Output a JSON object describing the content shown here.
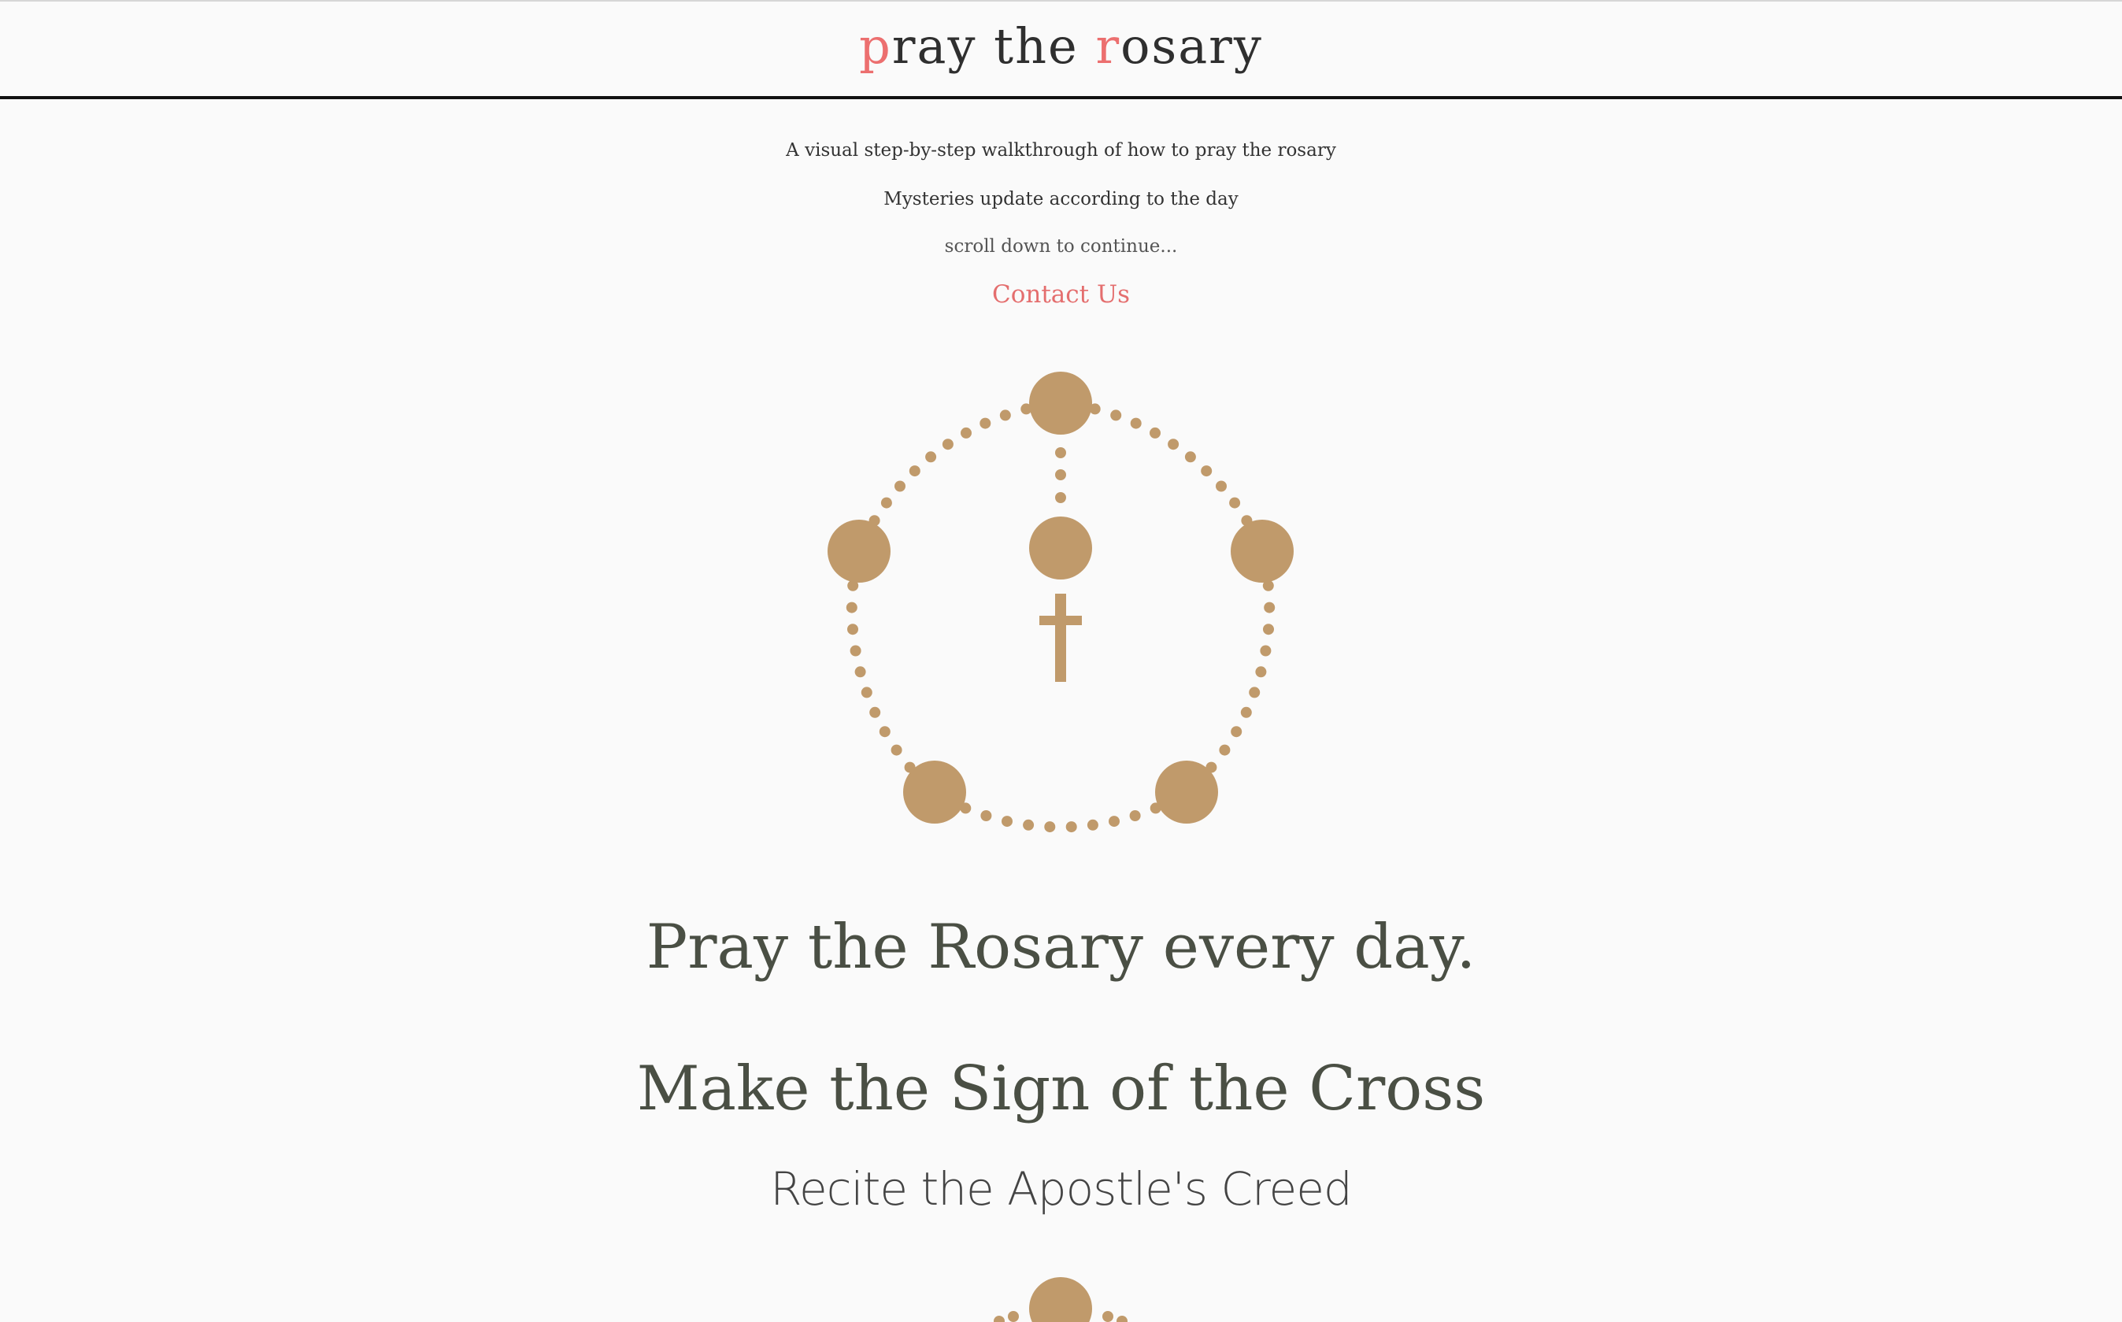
{
  "header": {
    "brand_p": "p",
    "brand_rest1": "ray the ",
    "brand_r": "r",
    "brand_rest2": "osary"
  },
  "intro": {
    "tagline": "A visual step-by-step walkthrough of how to pray the rosary",
    "mysteries_note": "Mysteries update according to the day",
    "scroll_hint": "scroll down to continue...",
    "contact_link": "Contact Us"
  },
  "steps": {
    "headline": "Pray the Rosary every day.",
    "step_title": "Make the Sign of the Cross",
    "step_instruction": "Recite the Apostle's Creed"
  },
  "colors": {
    "accent": "#ec6f6f",
    "bead": "#c09a6b",
    "heading": "#4a4f44",
    "background": "#fafafa"
  },
  "icons": {
    "rosary": "rosary-icon",
    "cross": "cross-icon"
  }
}
